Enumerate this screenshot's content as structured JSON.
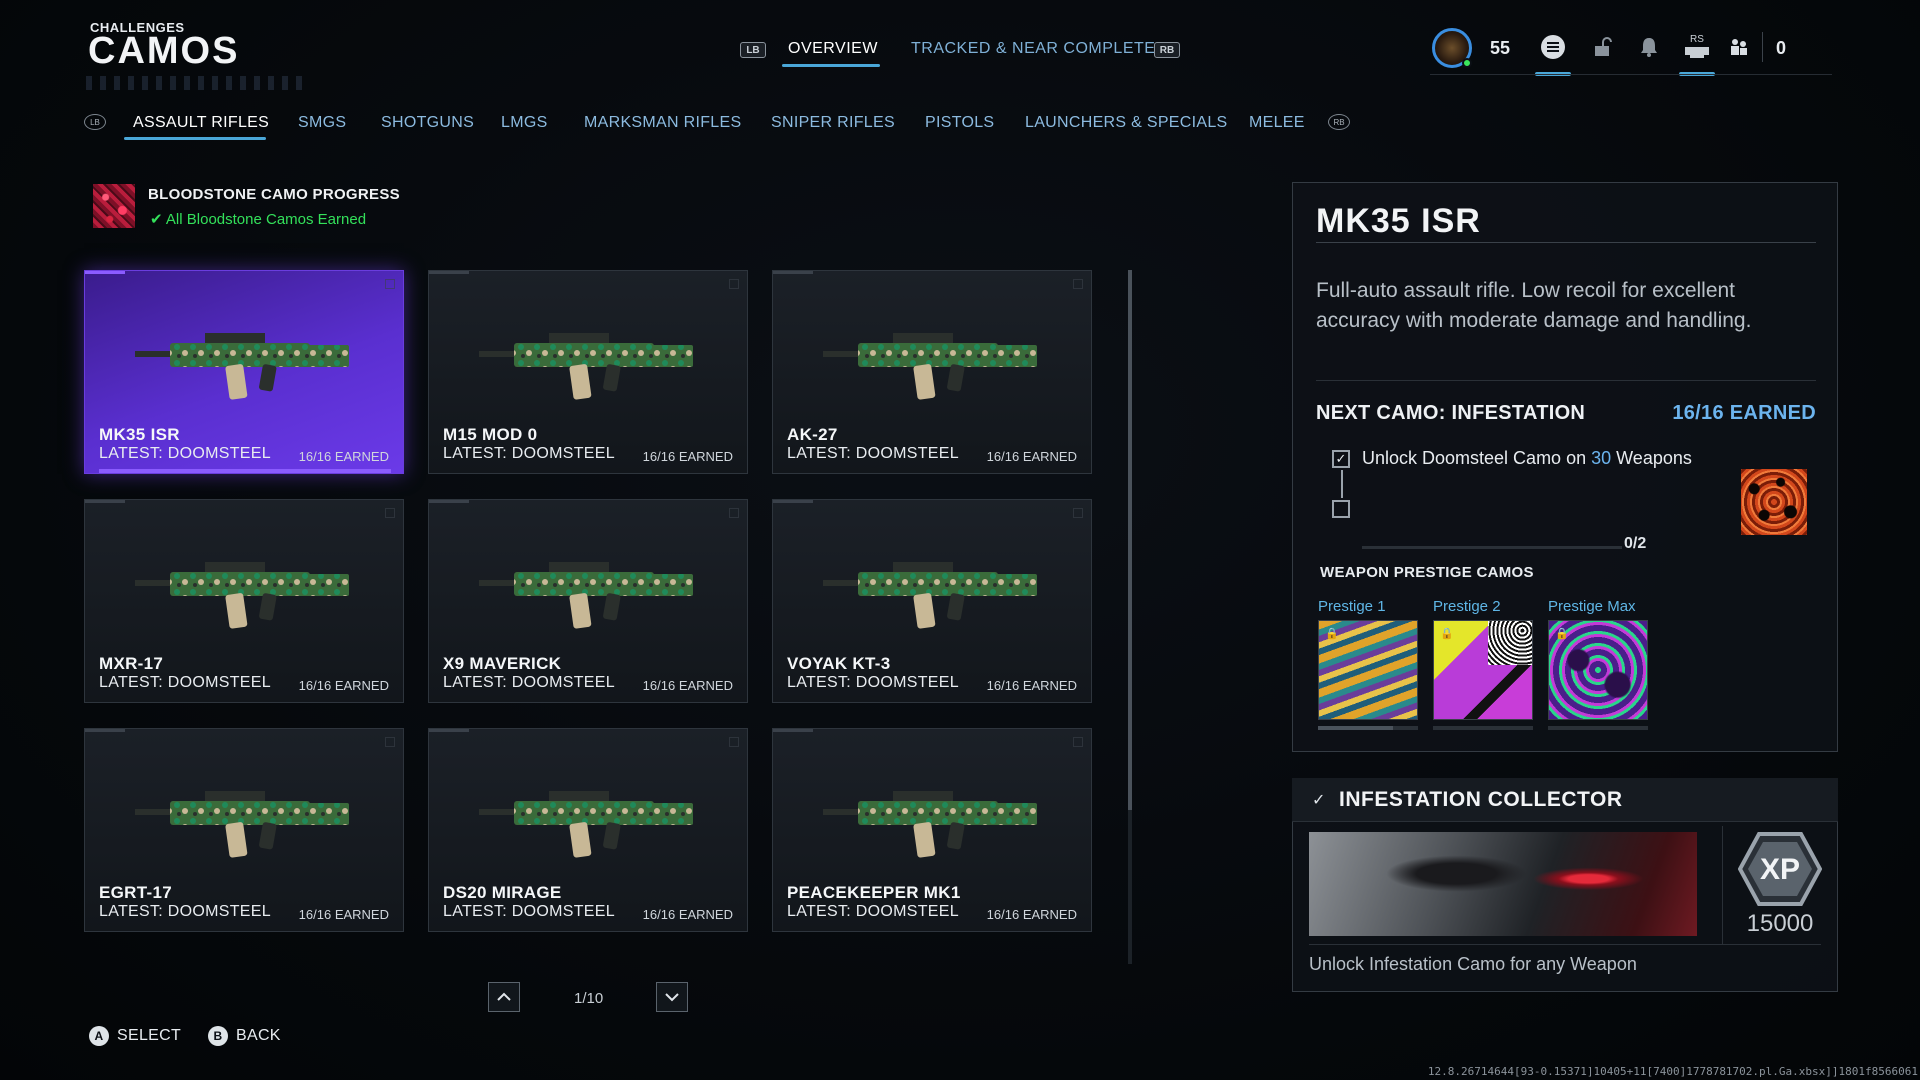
{
  "header": {
    "section": "CHALLENGES",
    "title": "CAMOS",
    "lb": "LB",
    "rb": "RB",
    "tabs": [
      {
        "label": "OVERVIEW",
        "active": true
      },
      {
        "label": "TRACKED & NEAR COMPLETE",
        "active": false
      }
    ],
    "level": "55",
    "rs": "RS",
    "notification_count": "0"
  },
  "categories": {
    "left_bumper": "LB",
    "right_bumper": "RB",
    "items": [
      "ASSAULT RIFLES",
      "SMGS",
      "SHOTGUNS",
      "LMGS",
      "MARKSMAN RIFLES",
      "SNIPER RIFLES",
      "PISTOLS",
      "LAUNCHERS & SPECIALS",
      "MELEE"
    ],
    "active": "ASSAULT RIFLES"
  },
  "bloodstone": {
    "title": "BLOODSTONE CAMO PROGRESS",
    "status": "All Bloodstone Camos Earned"
  },
  "weapons": [
    {
      "name": "MK35 ISR",
      "latest": "LATEST: DOOMSTEEL",
      "earned": "16/16 EARNED",
      "selected": true
    },
    {
      "name": "M15 MOD 0",
      "latest": "LATEST: DOOMSTEEL",
      "earned": "16/16 EARNED"
    },
    {
      "name": "AK-27",
      "latest": "LATEST: DOOMSTEEL",
      "earned": "16/16 EARNED"
    },
    {
      "name": "MXR-17",
      "latest": "LATEST: DOOMSTEEL",
      "earned": "16/16 EARNED"
    },
    {
      "name": "X9 MAVERICK",
      "latest": "LATEST: DOOMSTEEL",
      "earned": "16/16 EARNED"
    },
    {
      "name": "VOYAK KT-3",
      "latest": "LATEST: DOOMSTEEL",
      "earned": "16/16 EARNED"
    },
    {
      "name": "EGRT-17",
      "latest": "LATEST: DOOMSTEEL",
      "earned": "16/16 EARNED"
    },
    {
      "name": "DS20 MIRAGE",
      "latest": "LATEST: DOOMSTEEL",
      "earned": "16/16 EARNED"
    },
    {
      "name": "PEACEKEEPER MK1",
      "latest": "LATEST: DOOMSTEEL",
      "earned": "16/16 EARNED"
    }
  ],
  "pager": {
    "text": "1/10"
  },
  "hints": {
    "select": "SELECT",
    "back": "BACK",
    "a": "A",
    "b": "B"
  },
  "build": "12.8.26714644[93-0.15371]10405+11[7400]1778781702.pl.Ga.xbsx]]1801f8566061",
  "detail": {
    "title": "MK35 ISR",
    "description": "Full-auto assault rifle. Low recoil for excellent accuracy with moderate damage and handling.",
    "next_camo": "NEXT CAMO: INFESTATION",
    "earned": "16/16 EARNED",
    "challenge_pre": "Unlock Doomsteel Camo on ",
    "challenge_num": "30",
    "challenge_post": " Weapons",
    "progress": "0/2",
    "progress_value": 0,
    "prestige_header": "WEAPON PRESTIGE CAMOS",
    "prestige": [
      {
        "label": "Prestige 1",
        "progress": 0.75
      },
      {
        "label": "Prestige 2",
        "progress": 0
      },
      {
        "label": "Prestige Max",
        "progress": 0
      }
    ]
  },
  "collector": {
    "title": "INFESTATION COLLECTOR",
    "xp_badge": "XP",
    "xp": "15000",
    "description": "Unlock Infestation Camo for any Weapon"
  },
  "colors": {
    "accent_blue": "#4aa7d8",
    "selected_purple": "#5a2fd0",
    "earned_green": "#33e05a",
    "highlight_blue": "#6cb4ee"
  }
}
